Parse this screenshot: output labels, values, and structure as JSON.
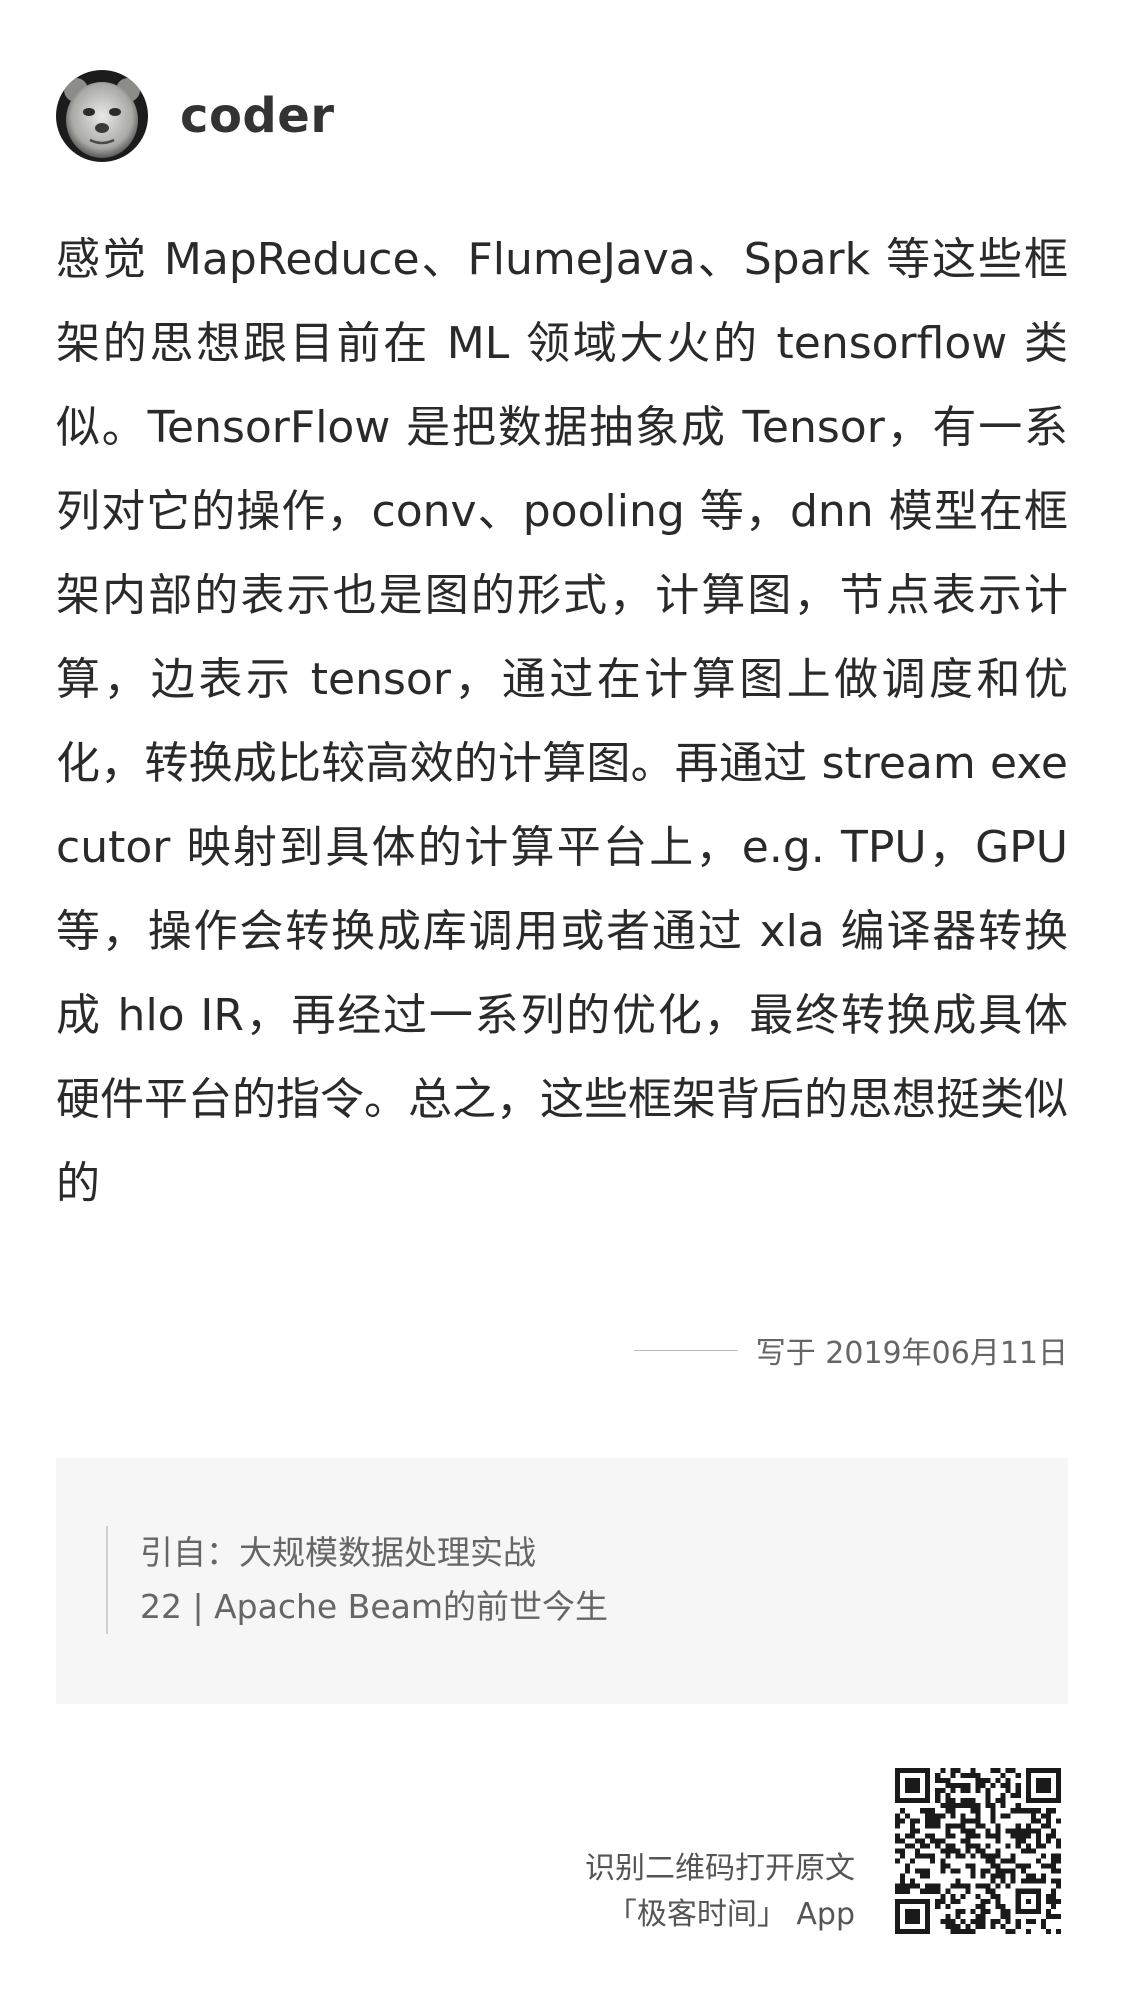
{
  "header": {
    "username": "coder",
    "avatar_icon": "bear-avatar-icon"
  },
  "post": {
    "body": "感觉 MapReduce、FlumeJava、Spark 等这些框架的思想跟目前在 ML 领域大火的 tensorflow 类似。TensorFlow 是把数据抽象成 Tensor，有一系列对它的操作，conv、pooling 等，dnn 模型在框架内部的表示也是图的形式，计算图，节点表示计算，边表示 tensor，通过在计算图上做调度和优化，转换成比较高效的计算图。再通过 stream executor 映射到具体的计算平台上，e.g. TPU，GPU 等，操作会转换成库调用或者通过 xla 编译器转换成 hlo IR，再经过一系列的优化，最终转换成具体硬件平台的指令。总之，这些框架背后的思想挺类似的",
    "date": "写于 2019年06月11日"
  },
  "quote": {
    "line1": "引自：大规模数据处理实战",
    "line2": "22 | Apache Beam的前世今生"
  },
  "footer": {
    "line1": "识别二维码打开原文",
    "line2": "「极客时间」 App",
    "qr_icon": "qr-code-icon"
  },
  "colors": {
    "text": "#2a2a2a",
    "muted": "#666666",
    "quote_bg": "#f6f6f6"
  }
}
